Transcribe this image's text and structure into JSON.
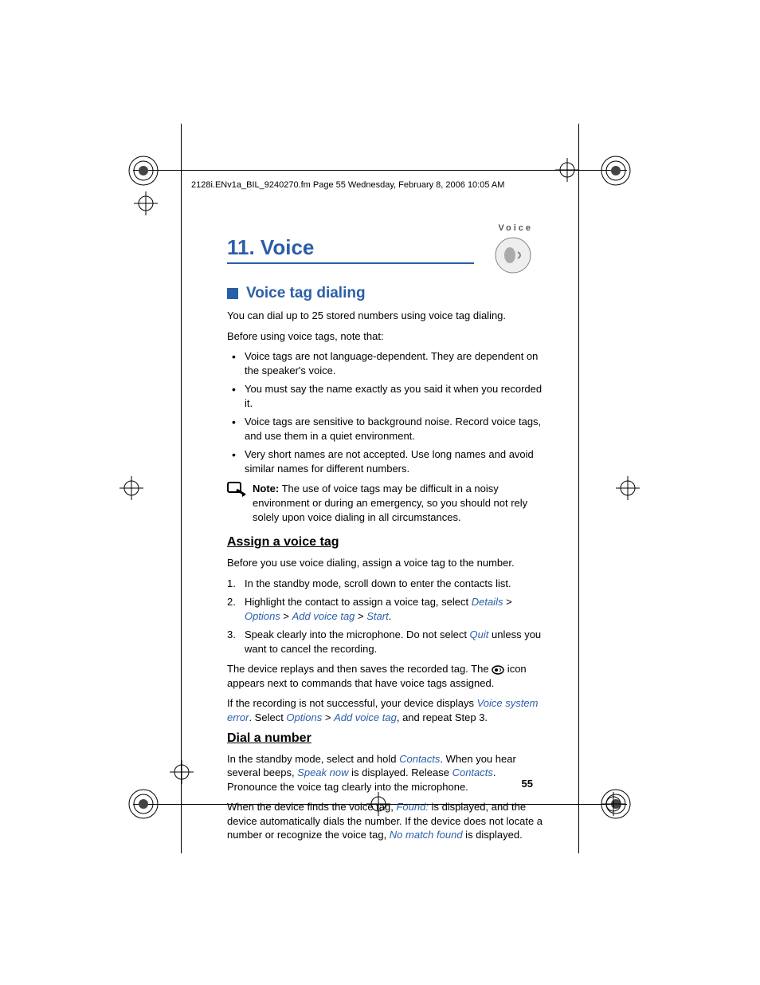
{
  "header": "2128i.ENv1a_BIL_9240270.fm  Page 55  Wednesday, February 8, 2006  10:05 AM",
  "sectionLabel": "Voice",
  "chapterTitle": "11. Voice",
  "section1": {
    "title": "Voice tag dialing",
    "intro1": "You can dial up to 25 stored numbers using voice tag dialing.",
    "intro2": "Before using voice tags, note that:",
    "bullets": [
      "Voice tags are not language-dependent. They are dependent on the speaker's voice.",
      "You must say the name exactly as you said it when you recorded it.",
      "Voice tags are sensitive to background noise. Record voice tags, and use them in a quiet environment.",
      "Very short names are not accepted. Use long names and avoid similar names for different numbers."
    ],
    "noteLabel": "Note:",
    "noteText": " The use of voice tags may be difficult in a noisy environment or during an emergency, so you should not rely solely upon voice dialing in all circumstances."
  },
  "sub1": {
    "title": "Assign a voice tag",
    "intro": "Before you use voice dialing, assign a voice tag to the number.",
    "step1": "In the standby mode, scroll down to enter the contacts list.",
    "step2_a": "Highlight the contact to assign a voice tag, select ",
    "step2_link1": "Details",
    "step2_gt1": " > ",
    "step2_link2": "Options",
    "step2_gt2": " > ",
    "step2_link3": "Add voice tag",
    "step2_gt3": " > ",
    "step2_link4": "Start",
    "step2_end": ".",
    "step3_a": "Speak clearly into the microphone. Do not select ",
    "step3_link": "Quit",
    "step3_b": " unless you want to cancel the recording.",
    "after1_a": "The device replays and then saves the recorded tag. The ",
    "after1_b": " icon appears next to commands that have voice tags assigned.",
    "after2_a": "If the recording is not successful, your device displays ",
    "after2_link1": "Voice system error",
    "after2_b": ". Select ",
    "after2_link2": "Options",
    "after2_gt": " > ",
    "after2_link3": "Add voice tag",
    "after2_c": ", and repeat Step 3."
  },
  "sub2": {
    "title": "Dial a number",
    "p1_a": "In the standby mode, select and hold ",
    "p1_link1": "Contacts",
    "p1_b": ". When you hear several beeps, ",
    "p1_link2": "Speak now",
    "p1_c": " is displayed. Release ",
    "p1_link3": "Contacts",
    "p1_d": ". Pronounce the voice tag clearly into the microphone.",
    "p2_a": "When the device finds the voice tag, ",
    "p2_link1": "Found:",
    "p2_b": " is displayed, and the device automatically dials the number. If the device does not locate a number or recognize the voice tag, ",
    "p2_link2": "No match found",
    "p2_c": " is displayed."
  },
  "pageNum": "55"
}
